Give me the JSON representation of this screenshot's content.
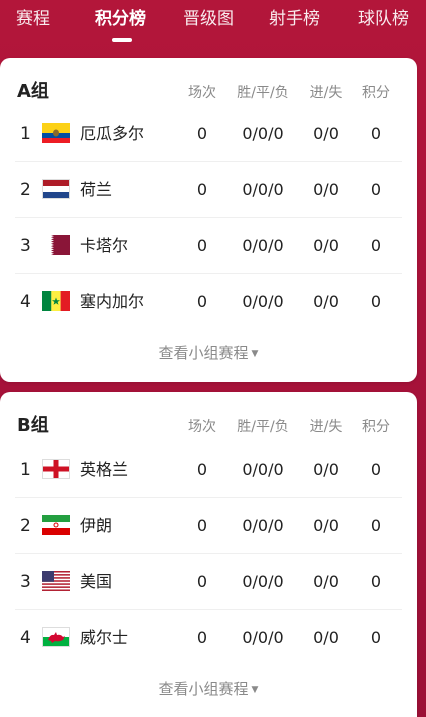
{
  "tabs": [
    {
      "label": "赛程",
      "active": false
    },
    {
      "label": "积分榜",
      "active": true
    },
    {
      "label": "晋级图",
      "active": false
    },
    {
      "label": "射手榜",
      "active": false
    },
    {
      "label": "球队榜",
      "active": false
    }
  ],
  "columns": {
    "played": "场次",
    "wdl": "胜/平/负",
    "gd": "进/失",
    "pts": "积分"
  },
  "groups": [
    {
      "title": "A组",
      "more_label": "查看小组赛程",
      "teams": [
        {
          "rank": "1",
          "name": "厄瓜多尔",
          "flag": "ecuador-flag-icon",
          "played": "0",
          "wdl": "0/0/0",
          "gd": "0/0",
          "pts": "0"
        },
        {
          "rank": "2",
          "name": "荷兰",
          "flag": "netherlands-flag-icon",
          "played": "0",
          "wdl": "0/0/0",
          "gd": "0/0",
          "pts": "0"
        },
        {
          "rank": "3",
          "name": "卡塔尔",
          "flag": "qatar-flag-icon",
          "played": "0",
          "wdl": "0/0/0",
          "gd": "0/0",
          "pts": "0"
        },
        {
          "rank": "4",
          "name": "塞内加尔",
          "flag": "senegal-flag-icon",
          "played": "0",
          "wdl": "0/0/0",
          "gd": "0/0",
          "pts": "0"
        }
      ]
    },
    {
      "title": "B组",
      "more_label": "查看小组赛程",
      "teams": [
        {
          "rank": "1",
          "name": "英格兰",
          "flag": "england-flag-icon",
          "played": "0",
          "wdl": "0/0/0",
          "gd": "0/0",
          "pts": "0"
        },
        {
          "rank": "2",
          "name": "伊朗",
          "flag": "iran-flag-icon",
          "played": "0",
          "wdl": "0/0/0",
          "gd": "0/0",
          "pts": "0"
        },
        {
          "rank": "3",
          "name": "美国",
          "flag": "usa-flag-icon",
          "played": "0",
          "wdl": "0/0/0",
          "gd": "0/0",
          "pts": "0"
        },
        {
          "rank": "4",
          "name": "威尔士",
          "flag": "wales-flag-icon",
          "played": "0",
          "wdl": "0/0/0",
          "gd": "0/0",
          "pts": "0"
        }
      ]
    }
  ],
  "colors": {
    "header_bg": "#a8123a",
    "card_bg": "#ffffff",
    "muted_text": "#8a8a8a"
  }
}
